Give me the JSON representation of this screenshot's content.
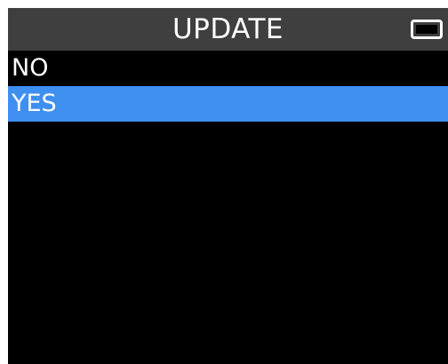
{
  "header": {
    "title": "UPDATE",
    "battery_icon": "battery-icon"
  },
  "menu": {
    "items": [
      {
        "label": "NO",
        "selected": false
      },
      {
        "label": "YES",
        "selected": true
      }
    ]
  },
  "colors": {
    "titlebar": "#3f3f3f",
    "selection": "#3f8ff0",
    "screen": "#000000",
    "text": "#ffffff"
  }
}
